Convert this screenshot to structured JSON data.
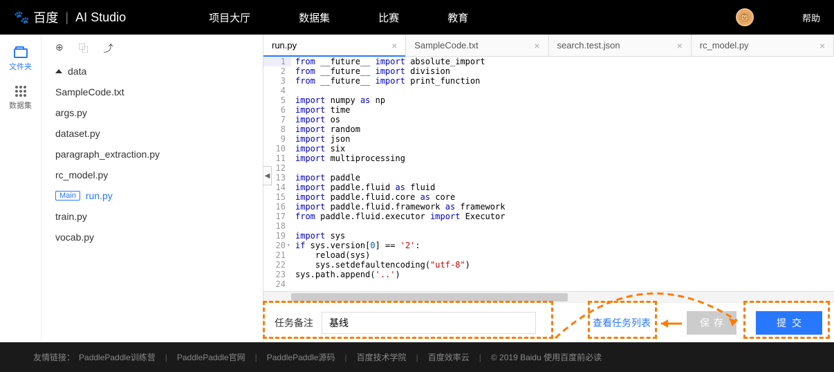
{
  "nav": {
    "logo_baidu": "百度",
    "logo_studio": "AI Studio",
    "items": [
      "项目大厅",
      "数据集",
      "比赛",
      "教育"
    ],
    "help": "帮助"
  },
  "leftcol": {
    "files": "文件夹",
    "datasets": "数据集"
  },
  "files": {
    "folder": "data",
    "list": [
      "SampleCode.txt",
      "args.py",
      "dataset.py",
      "paragraph_extraction.py",
      "rc_model.py"
    ],
    "main_badge": "Main",
    "main_file": "run.py",
    "rest": [
      "train.py",
      "vocab.py"
    ]
  },
  "tabs": [
    "run.py",
    "SampleCode.txt",
    "search.test.json",
    "rc_model.py"
  ],
  "code": [
    {
      "n": 1,
      "h": "<span class='kw'>from</span> __future__ <span class='kw'>import</span> absolute_import"
    },
    {
      "n": 2,
      "h": "<span class='kw'>from</span> __future__ <span class='kw'>import</span> division"
    },
    {
      "n": 3,
      "h": "<span class='kw'>from</span> __future__ <span class='kw'>import</span> print_function"
    },
    {
      "n": 4,
      "h": ""
    },
    {
      "n": 5,
      "h": "<span class='kw'>import</span> numpy <span class='kw'>as</span> np"
    },
    {
      "n": 6,
      "h": "<span class='kw'>import</span> time"
    },
    {
      "n": 7,
      "h": "<span class='kw'>import</span> os"
    },
    {
      "n": 8,
      "h": "<span class='kw'>import</span> random"
    },
    {
      "n": 9,
      "h": "<span class='kw'>import</span> json"
    },
    {
      "n": 10,
      "h": "<span class='kw'>import</span> six"
    },
    {
      "n": 11,
      "h": "<span class='kw'>import</span> multiprocessing"
    },
    {
      "n": 12,
      "h": ""
    },
    {
      "n": 13,
      "h": "<span class='kw'>import</span> paddle"
    },
    {
      "n": 14,
      "h": "<span class='kw'>import</span> paddle.fluid <span class='kw'>as</span> fluid"
    },
    {
      "n": 15,
      "h": "<span class='kw'>import</span> paddle.fluid.core <span class='kw'>as</span> core"
    },
    {
      "n": 16,
      "h": "<span class='kw'>import</span> paddle.fluid.framework <span class='kw'>as</span> framework"
    },
    {
      "n": 17,
      "h": "<span class='kw'>from</span> paddle.fluid.executor <span class='kw'>import</span> Executor"
    },
    {
      "n": 18,
      "h": ""
    },
    {
      "n": 19,
      "h": "<span class='kw'>import</span> sys"
    },
    {
      "n": 20,
      "h": "<span class='kw'>if</span> sys.version[<span class='num'>0</span>] == <span class='str'>'2'</span>:",
      "c": true
    },
    {
      "n": 21,
      "h": "    reload(sys)"
    },
    {
      "n": 22,
      "h": "    sys.setdefaultencoding(<span class='str'>\"utf-8\"</span>)"
    },
    {
      "n": 23,
      "h": "sys.path.append(<span class='str'>'..'</span>)"
    },
    {
      "n": 24,
      "h": ""
    }
  ],
  "bottombar": {
    "label": "任务备注",
    "value": "基线",
    "view_tasks": "查看任务列表",
    "save": "保存",
    "submit": "提交"
  },
  "footer": {
    "prefix": "友情链接：",
    "links": [
      "PaddlePaddle训练营",
      "PaddlePaddle官网",
      "PaddlePaddle源码",
      "百度技术学院",
      "百度效率云"
    ],
    "copyright": "© 2019 Baidu 使用百度前必读"
  }
}
